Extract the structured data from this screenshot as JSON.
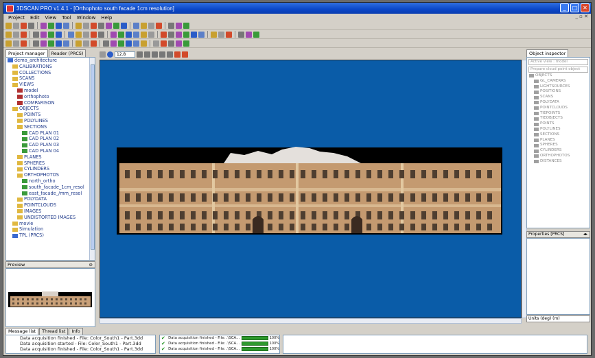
{
  "window": {
    "title": "3DSCAN PRO v1.4.1 - [Orthophoto south facade 1cm resolution]"
  },
  "menu": [
    "Project",
    "Edit",
    "View",
    "Tool",
    "Window",
    "Help"
  ],
  "left_tabs": [
    "Project manager",
    "Reader (PRCS)"
  ],
  "tree": [
    {
      "label": "demo_architecture",
      "indent": 0,
      "color": "#3a6ad0"
    },
    {
      "label": "CALIBRATIONS",
      "indent": 1,
      "color": "#e0b840"
    },
    {
      "label": "COLLECTIONS",
      "indent": 1,
      "color": "#e0b840"
    },
    {
      "label": "SCANS",
      "indent": 1,
      "color": "#e0b840"
    },
    {
      "label": "VIEWS",
      "indent": 1,
      "color": "#e0b840"
    },
    {
      "label": "model",
      "indent": 2,
      "color": "#b03030"
    },
    {
      "label": "orthophoto",
      "indent": 2,
      "color": "#b03030"
    },
    {
      "label": "COMPARISON",
      "indent": 2,
      "color": "#b03030"
    },
    {
      "label": "OBJECTS",
      "indent": 1,
      "color": "#e0b840"
    },
    {
      "label": "POINTS",
      "indent": 2,
      "color": "#e0b840"
    },
    {
      "label": "POLYLINES",
      "indent": 2,
      "color": "#e0b840"
    },
    {
      "label": "SECTIONS",
      "indent": 2,
      "color": "#e0b840"
    },
    {
      "label": "CAD PLAN 01",
      "indent": 3,
      "color": "#3a9a3a"
    },
    {
      "label": "CAD PLAN 02",
      "indent": 3,
      "color": "#3a9a3a"
    },
    {
      "label": "CAD PLAN 03",
      "indent": 3,
      "color": "#3a9a3a"
    },
    {
      "label": "CAD PLAN 04",
      "indent": 3,
      "color": "#3a9a3a"
    },
    {
      "label": "PLANES",
      "indent": 2,
      "color": "#e0b840"
    },
    {
      "label": "SPHERES",
      "indent": 2,
      "color": "#e0b840"
    },
    {
      "label": "CYLINDERS",
      "indent": 2,
      "color": "#e0b840"
    },
    {
      "label": "ORTHOPHOTOS",
      "indent": 2,
      "color": "#e0b840"
    },
    {
      "label": "north_ortho",
      "indent": 3,
      "color": "#3a9a3a"
    },
    {
      "label": "south_facade_1cm_resol",
      "indent": 3,
      "color": "#3a9a3a"
    },
    {
      "label": "east_facade_/mm_resol",
      "indent": 3,
      "color": "#3a9a3a"
    },
    {
      "label": "POLYDATA",
      "indent": 2,
      "color": "#e0b840"
    },
    {
      "label": "POINTCLOUDS",
      "indent": 2,
      "color": "#e0b840"
    },
    {
      "label": "IMAGES",
      "indent": 2,
      "color": "#e0b840"
    },
    {
      "label": "UNDISTORTED IMAGES",
      "indent": 2,
      "color": "#e0b840"
    },
    {
      "label": "movie",
      "indent": 1,
      "color": "#e0b840"
    },
    {
      "label": "Simulation",
      "indent": 1,
      "color": "#e0b840"
    },
    {
      "label": "TPL (PRCS)",
      "indent": 1,
      "color": "#3a6ad0"
    }
  ],
  "preview_label": "Preview",
  "zoom_value": "12.8",
  "right": {
    "tab": "Object inspector",
    "search_placeholder": "Active view : model",
    "filter_placeholder": "Prepare cloud point object",
    "items": [
      "OBJECTS",
      "GL_CAMERAS",
      "LIGHTSOURCES",
      "POSITIONS",
      "SCANS",
      "POLYDATA",
      "POINTCLOUDS",
      "TIEPOINTS",
      "TIEOBJECTS",
      "POINTS",
      "POLYLINES",
      "SECTIONS",
      "PLANES",
      "SPHERES",
      "CYLINDERS",
      "ORTHOPHOTOS",
      "DISTANCES"
    ],
    "properties_label": "Properties [PRCS]",
    "properties_pin": "◂▸",
    "units_label": "Units (deg) (m)"
  },
  "bottom": {
    "tabs": [
      "Message list",
      "Thread list",
      "Info"
    ],
    "messages": [
      "Data acquisition finished - File: Color_South1 - Part.3dd",
      "Data acquisition started - File: Color_South1 - Part.3dd",
      "Data acquisition finished - File: Color_South1 - Part.3dd"
    ],
    "threads": [
      {
        "label": "Data acquisition finished - File: .\\SCA...",
        "pct": "100%",
        "progress": 1.0
      },
      {
        "label": "Data acquisition finished - File: .\\SCA...",
        "pct": "100%",
        "progress": 1.0
      },
      {
        "label": "Data acquisition finished - File: .\\SCA...",
        "pct": "100%",
        "progress": 1.0
      }
    ]
  },
  "colors": {
    "viewport_bg": "#0a5ca8",
    "title_bar": "#0b47c8"
  }
}
